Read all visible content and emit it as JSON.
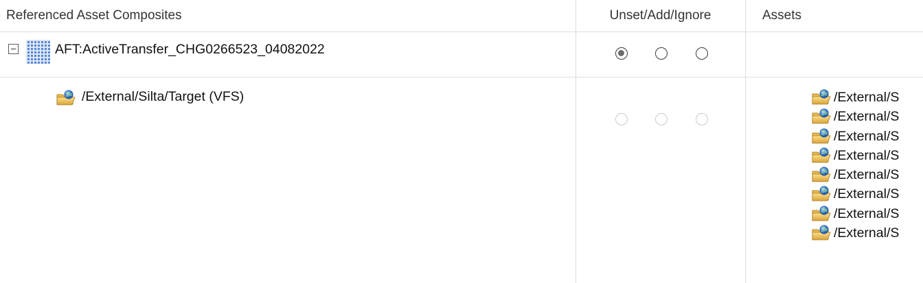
{
  "header": {
    "col1": "Referenced Asset Composites",
    "col2": "Unset/Add/Ignore",
    "col3": "Assets"
  },
  "rows": [
    {
      "label": "AFT:ActiveTransfer_CHG0266523_04082022",
      "icon": "grid-composite-icon",
      "radios": [
        "checked",
        "unchecked",
        "unchecked"
      ]
    },
    {
      "label": "/External/Silta/Target (VFS)",
      "icon": "vfs-folder-icon",
      "radios": [
        "disabled",
        "disabled",
        "disabled"
      ]
    }
  ],
  "assets": [
    "/External/S",
    "/External/S",
    "/External/S",
    "/External/S",
    "/External/S",
    "/External/S",
    "/External/S",
    "/External/S"
  ],
  "colors": {
    "grid_line": "#dcdcdc",
    "radio_checked": "#6b6b6b",
    "radio_disabled": "#c9c9c9"
  }
}
